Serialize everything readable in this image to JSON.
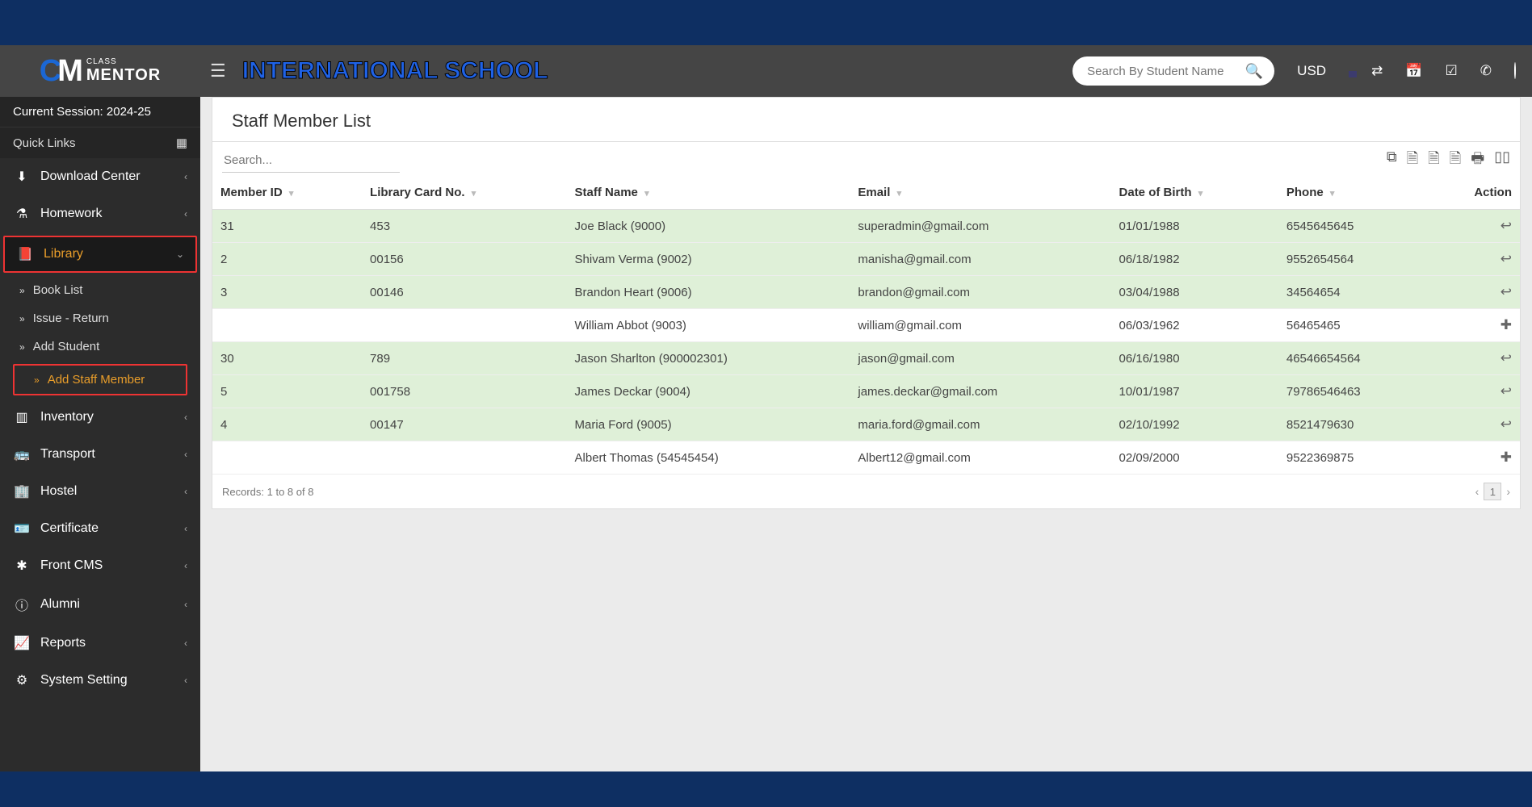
{
  "header": {
    "logoTop": "CLASS",
    "logoBottom": "MENTOR",
    "schoolName": "INTERNATIONAL SCHOOL",
    "searchPlaceholder": "Search By Student Name",
    "currency": "USD"
  },
  "sidebar": {
    "session": "Current Session: 2024-25",
    "quickLinks": "Quick Links",
    "items": [
      {
        "icon": "⬇",
        "label": "Download Center",
        "chev": "‹"
      },
      {
        "icon": "⚗",
        "label": "Homework",
        "chev": "‹"
      },
      {
        "icon": "📕",
        "label": "Library",
        "chev": "⌄",
        "highlight": true,
        "subs": [
          {
            "label": "Book List"
          },
          {
            "label": "Issue - Return"
          },
          {
            "label": "Add Student"
          },
          {
            "label": "Add Staff Member",
            "highlight": true
          }
        ]
      },
      {
        "icon": "▥",
        "label": "Inventory",
        "chev": "‹"
      },
      {
        "icon": "🚌",
        "label": "Transport",
        "chev": "‹"
      },
      {
        "icon": "🏢",
        "label": "Hostel",
        "chev": "‹"
      },
      {
        "icon": "🪪",
        "label": "Certificate",
        "chev": "‹"
      },
      {
        "icon": "✱",
        "label": "Front CMS",
        "chev": "‹"
      },
      {
        "icon": "ⓘ",
        "label": "Alumni",
        "chev": "‹"
      },
      {
        "icon": "📈",
        "label": "Reports",
        "chev": "‹"
      },
      {
        "icon": "⚙",
        "label": "System Setting",
        "chev": "‹"
      }
    ]
  },
  "page": {
    "title": "Staff Member List",
    "searchPlaceholder": "Search...",
    "columns": [
      "Member ID",
      "Library Card No.",
      "Staff Name",
      "Email",
      "Date of Birth",
      "Phone",
      "Action"
    ],
    "rows": [
      {
        "green": true,
        "memberId": "31",
        "card": "453",
        "name": "Joe Black (9000)",
        "email": "superadmin@gmail.com",
        "dob": "01/01/1988",
        "phone": "6545645645",
        "action": "reply"
      },
      {
        "green": true,
        "memberId": "2",
        "card": "00156",
        "name": "Shivam Verma (9002)",
        "email": "manisha@gmail.com",
        "dob": "06/18/1982",
        "phone": "9552654564",
        "action": "reply"
      },
      {
        "green": true,
        "memberId": "3",
        "card": "00146",
        "name": "Brandon Heart (9006)",
        "email": "brandon@gmail.com",
        "dob": "03/04/1988",
        "phone": "34564654",
        "action": "reply"
      },
      {
        "green": false,
        "memberId": "",
        "card": "",
        "name": "William Abbot (9003)",
        "email": "william@gmail.com",
        "dob": "06/03/1962",
        "phone": "56465465",
        "action": "plus"
      },
      {
        "green": true,
        "memberId": "30",
        "card": "789",
        "name": "Jason Sharlton (900002301)",
        "email": "jason@gmail.com",
        "dob": "06/16/1980",
        "phone": "46546654564",
        "action": "reply"
      },
      {
        "green": true,
        "memberId": "5",
        "card": "001758",
        "name": "James Deckar (9004)",
        "email": "james.deckar@gmail.com",
        "dob": "10/01/1987",
        "phone": "79786546463",
        "action": "reply"
      },
      {
        "green": true,
        "memberId": "4",
        "card": "00147",
        "name": "Maria Ford (9005)",
        "email": "maria.ford@gmail.com",
        "dob": "02/10/1992",
        "phone": "8521479630",
        "action": "reply"
      },
      {
        "green": false,
        "memberId": "",
        "card": "",
        "name": "Albert Thomas (54545454)",
        "email": "Albert12@gmail.com",
        "dob": "02/09/2000",
        "phone": "9522369875",
        "action": "plus"
      }
    ],
    "footer": "Records: 1 to 8 of 8",
    "page": "1"
  }
}
